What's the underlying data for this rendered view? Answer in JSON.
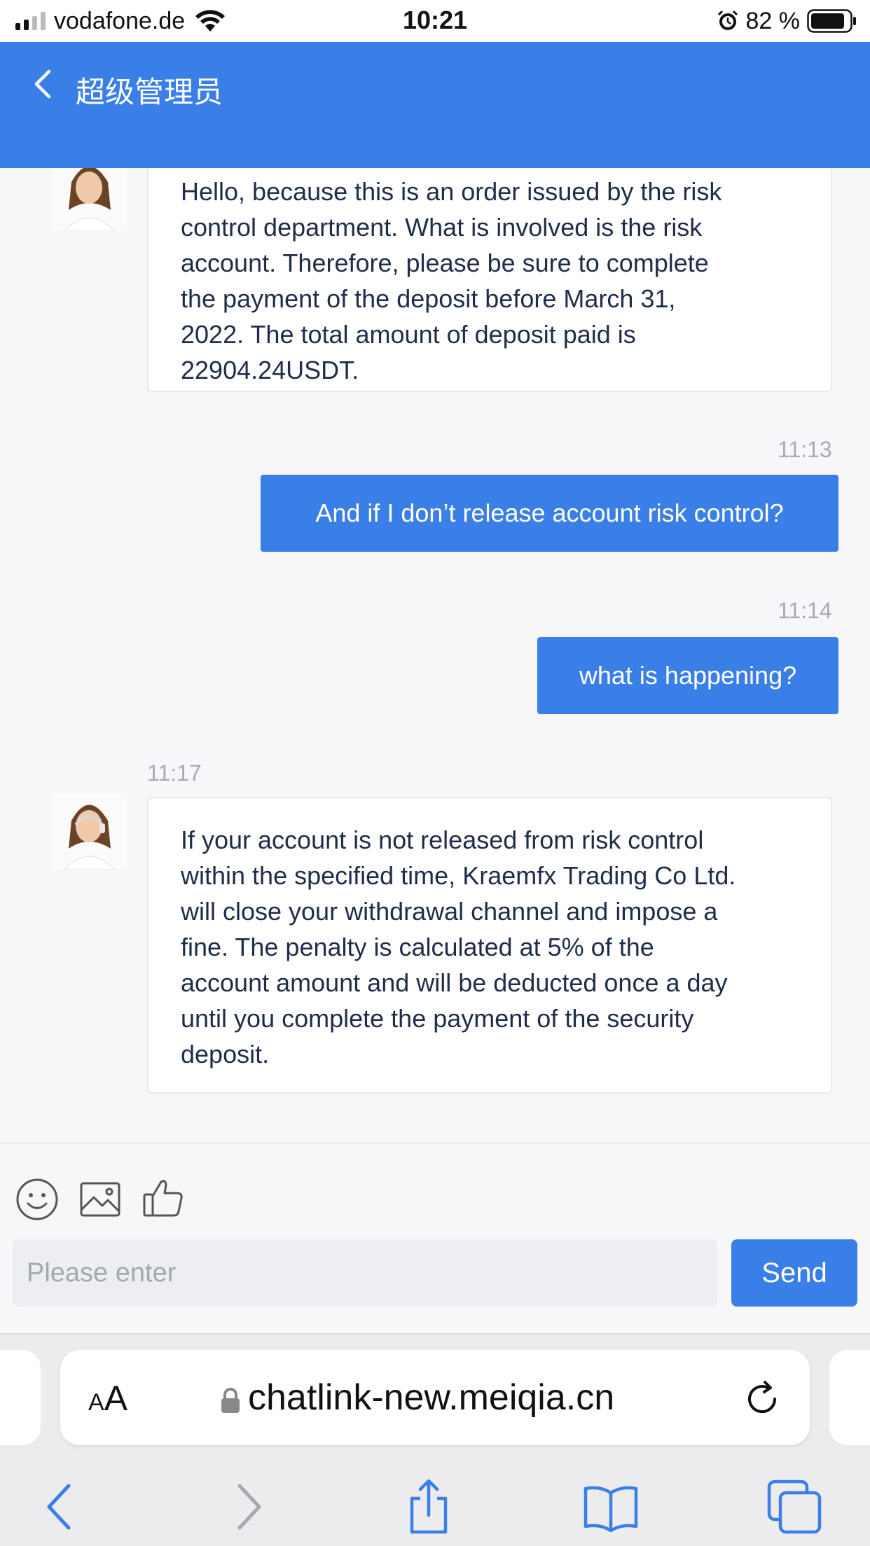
{
  "status_bar": {
    "carrier": "vodafone.de",
    "time": "10:21",
    "battery": "82 %"
  },
  "header": {
    "title": "超级管理员"
  },
  "messages": [
    {
      "from": "agent",
      "lines": [
        "Hello, because this is an order issued by the risk",
        "control department. What is involved is the risk",
        "account. Therefore, please be sure to complete",
        "the payment of the deposit before March 31,",
        "2022. The total amount of deposit paid is",
        "22904.24USDT."
      ]
    },
    {
      "from": "user",
      "time": "11:13",
      "text": "And if I don’t release account risk control?"
    },
    {
      "from": "user",
      "time": "11:14",
      "text": "what is happening?"
    },
    {
      "from": "agent",
      "time": "11:17",
      "lines": [
        "If your account is not released from risk control",
        "within the specified time, Kraemfx Trading Co Ltd.",
        "will close your withdrawal channel and impose a",
        "fine. The penalty is calculated at 5% of the",
        "account amount and will be deducted once a day",
        "until you complete the payment of the security",
        "deposit."
      ]
    }
  ],
  "composer": {
    "placeholder": "Please enter",
    "send_label": "Send",
    "tools": [
      "emoji-icon",
      "image-icon",
      "thumbs-up-icon"
    ]
  },
  "browser": {
    "aa_label_small": "A",
    "aa_label_big": "A",
    "url": "chatlink-new.meiqia.cn"
  },
  "colors": {
    "accent": "#3a7ee8",
    "background": "#f7f7f9",
    "bubble_border": "#e6e8ec",
    "timestamp": "#a6abb5"
  }
}
